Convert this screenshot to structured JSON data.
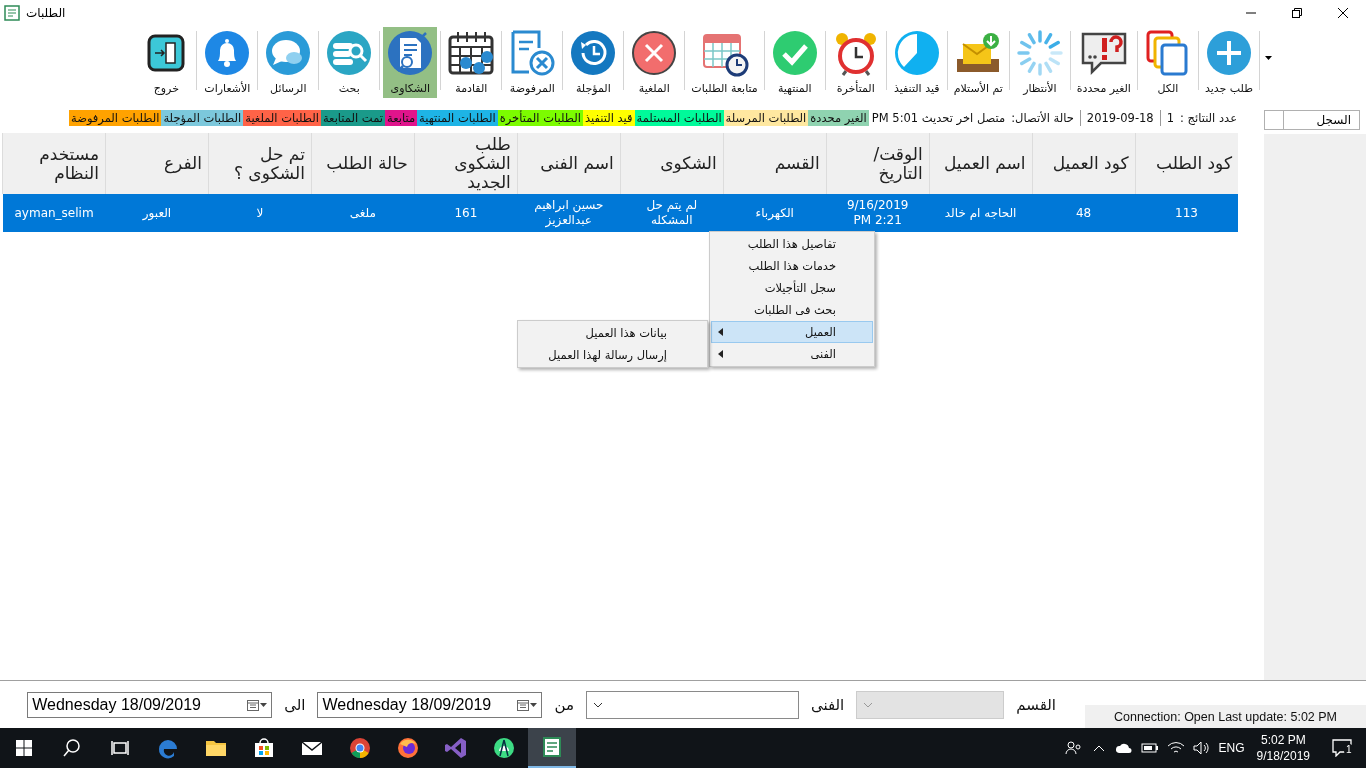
{
  "window": {
    "title": "الطلبات"
  },
  "toolbar": {
    "items": [
      {
        "label": "طلب جديد",
        "selected": false
      },
      {
        "label": "الكل",
        "selected": false
      },
      {
        "label": "الغير محددة",
        "selected": false
      },
      {
        "label": "الأنتظار",
        "selected": false
      },
      {
        "label": "تم الأستلام",
        "selected": false
      },
      {
        "label": "قيد التنفيذ",
        "selected": false
      },
      {
        "label": "المتأخرة",
        "selected": false
      },
      {
        "label": "المنتهية",
        "selected": false
      },
      {
        "label": "متابعة الطلبات",
        "selected": false
      },
      {
        "label": "الملغية",
        "selected": false
      },
      {
        "label": "المؤجلة",
        "selected": false
      },
      {
        "label": "المرفوضة",
        "selected": false
      },
      {
        "label": "القادمة",
        "selected": false
      },
      {
        "label": "الشكاوى",
        "selected": true
      },
      {
        "label": "بحث",
        "selected": false
      },
      {
        "label": "الرسائل",
        "selected": false
      },
      {
        "label": "الأشعارات",
        "selected": false
      },
      {
        "label": "خروج",
        "selected": false
      }
    ]
  },
  "log_panel": {
    "label": "السجل"
  },
  "status_strip": {
    "result_label": "عدد النتائج :",
    "result_count": "1",
    "date": "2019-09-18",
    "connection_label": "حالة الأتصال:",
    "connection_value": "متصل اخر تحديث PM 5:01",
    "legend": [
      {
        "label": "الغير محددة",
        "color": "#8fd3b0"
      },
      {
        "label": "الطلبات المرسلة",
        "color": "#ffe8a0"
      },
      {
        "label": "الطلبات المستلمة",
        "color": "#00fa9a"
      },
      {
        "label": "قيد التنفيذ",
        "color": "#ffff00"
      },
      {
        "label": "الطلبات المتأخرة",
        "color": "#7cfc00"
      },
      {
        "label": "الطلبات المنتهية",
        "color": "#1eb4e6"
      },
      {
        "label": "متابعة",
        "color": "#e0148c"
      },
      {
        "label": "تمت المتابعة",
        "color": "#1a9a8a"
      },
      {
        "label": "الطلبات الملغية",
        "color": "#ff6347"
      },
      {
        "label": "الطلبات المؤجلة",
        "color": "#7cc8dc"
      },
      {
        "label": "الطلبات المرفوضة",
        "color": "#ffa200"
      }
    ]
  },
  "table": {
    "columns": [
      "كود الطلب",
      "كود العميل",
      "اسم العميل",
      "الوقت/التاريخ",
      "القسم",
      "الشكوى",
      "اسم الفنى",
      "طلب الشكوى الجديد",
      "حالة الطلب",
      "تم حل الشكوى ؟",
      "الفرع",
      "مستخدم النظام"
    ],
    "rows": [
      {
        "selected": true,
        "cells": [
          "113",
          "48",
          "الحاجه ام خالد",
          "9/16/2019 PM 2:21",
          "الكهرباء",
          "لم يتم حل المشكله",
          "حسين ابراهيم عبدالعزيز",
          "161",
          "ملغى",
          "لا",
          "العبور",
          "ayman_selim"
        ]
      }
    ]
  },
  "context_menu": {
    "items": [
      {
        "label": "تفاصيل هذا الطلب",
        "has_submenu": false,
        "selected": false
      },
      {
        "label": "خدمات هذا الطلب",
        "has_submenu": false,
        "selected": false
      },
      {
        "label": "سجل التأجيلات",
        "has_submenu": false,
        "selected": false
      },
      {
        "label": "بحث فى الطلبات",
        "has_submenu": false,
        "selected": false
      },
      {
        "label": "العميل",
        "has_submenu": true,
        "selected": true
      },
      {
        "label": "الفنى",
        "has_submenu": true,
        "selected": false
      }
    ]
  },
  "submenu": {
    "items": [
      {
        "label": "بيانات هذا العميل"
      },
      {
        "label": "إرسال رسالة لهذا العميل"
      }
    ]
  },
  "filter_bar": {
    "department_label": "القسم",
    "department": {
      "disabled": true
    },
    "technician_label": "الفنى",
    "technician": {
      "disabled": false
    },
    "from_label": "من",
    "from_date": "Wednesday 18/09/2019",
    "to_label": "الى",
    "to_date": "Wednesday 18/09/2019"
  },
  "connection_status": "Connection: Open Last update: 5:02 PM",
  "taskbar": {
    "language": "ENG",
    "time": "5:02 PM",
    "date": "9/18/2019",
    "notification_count": "1"
  }
}
